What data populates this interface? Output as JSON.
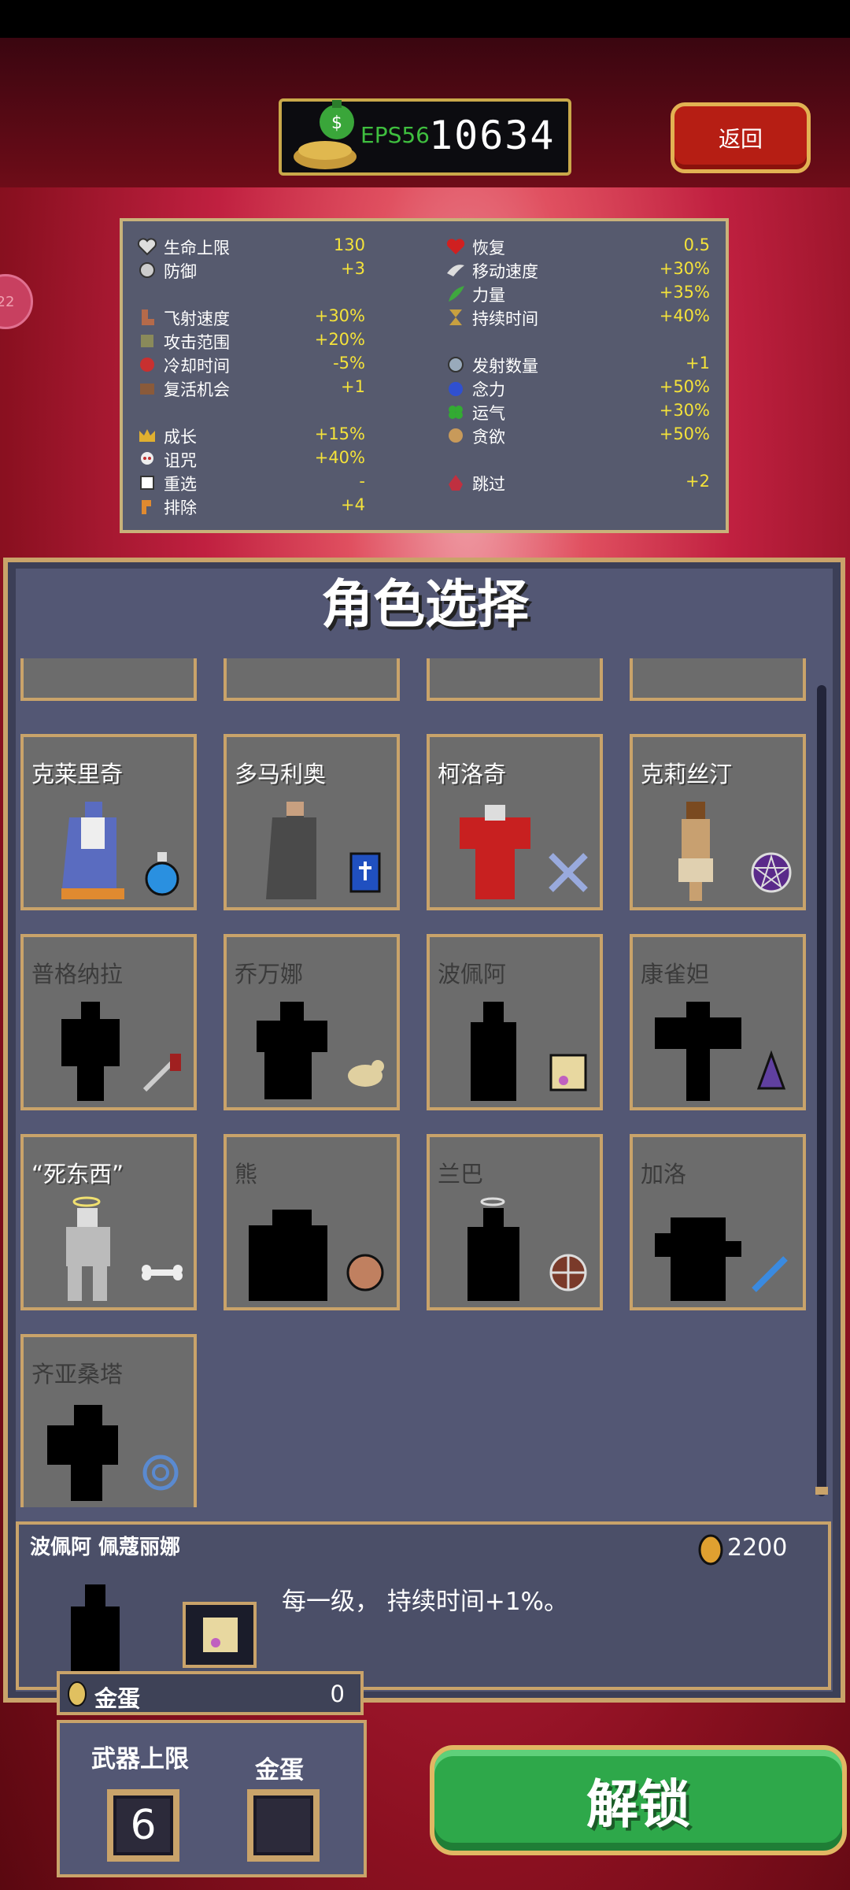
{
  "header": {
    "fps_label": "EPS56",
    "coins": "10634",
    "back_label": "返回"
  },
  "side_badge": "22",
  "stats": {
    "left": [
      {
        "label": "生命上限",
        "value": "130",
        "icon": "heart-icon"
      },
      {
        "label": "防御",
        "value": "+3",
        "icon": "armor-icon"
      },
      {
        "label": "飞射速度",
        "value": "+30%",
        "icon": "boot-icon"
      },
      {
        "label": "攻击范围",
        "value": "+20%",
        "icon": "area-icon"
      },
      {
        "label": "冷却时间",
        "value": "-5%",
        "icon": "cooldown-icon"
      },
      {
        "label": "复活机会",
        "value": "+1",
        "icon": "revival-icon"
      },
      {
        "label": "成长",
        "value": "+15%",
        "icon": "crown-icon"
      },
      {
        "label": "诅咒",
        "value": "+40%",
        "icon": "skull-icon"
      },
      {
        "label": "重选",
        "value": "-",
        "icon": "dice-icon"
      },
      {
        "label": "排除",
        "value": "+4",
        "icon": "banish-icon"
      }
    ],
    "right": [
      {
        "label": "恢复",
        "value": "0.5",
        "icon": "regen-heart-icon"
      },
      {
        "label": "移动速度",
        "value": "+30%",
        "icon": "wing-icon"
      },
      {
        "label": "力量",
        "value": "+35%",
        "icon": "feather-icon"
      },
      {
        "label": "持续时间",
        "value": "+40%",
        "icon": "hourglass-icon"
      },
      {
        "label": "发射数量",
        "value": "+1",
        "icon": "amount-icon"
      },
      {
        "label": "念力",
        "value": "+50%",
        "icon": "orb-icon"
      },
      {
        "label": "运气",
        "value": "+30%",
        "icon": "clover-icon"
      },
      {
        "label": "贪欲",
        "value": "+50%",
        "icon": "greed-icon"
      },
      {
        "label": "跳过",
        "value": "+2",
        "icon": "skip-icon"
      }
    ]
  },
  "title": "角色选择",
  "characters": [
    {
      "name": "克莱里奇",
      "locked": false,
      "item": "potion-icon"
    },
    {
      "name": "多马利奥",
      "locked": false,
      "item": "bible-icon"
    },
    {
      "name": "柯洛奇",
      "locked": false,
      "item": "cross-icon"
    },
    {
      "name": "克莉丝汀",
      "locked": false,
      "item": "pentagram-icon"
    },
    {
      "name": "普格纳拉",
      "locked": true,
      "item": "wand-icon"
    },
    {
      "name": "乔万娜",
      "locked": true,
      "item": "cat-icon"
    },
    {
      "name": "波佩阿",
      "locked": true,
      "item": "scroll-icon"
    },
    {
      "name": "康雀妲",
      "locked": true,
      "item": "bell-icon"
    },
    {
      "name": "“死东西”",
      "locked": false,
      "item": "bone-icon"
    },
    {
      "name": "熊",
      "locked": true,
      "item": "ball-icon"
    },
    {
      "name": "兰巴",
      "locked": true,
      "item": "wheel-icon"
    },
    {
      "name": "加洛",
      "locked": true,
      "item": "sword-icon"
    },
    {
      "name": "齐亚桑塔",
      "locked": true,
      "item": "spiral-icon"
    }
  ],
  "detail": {
    "name": "波佩阿 佩蔻丽娜",
    "price": "2200",
    "description": "每一级， 持续时间+1%。"
  },
  "golden_egg": {
    "label": "金蛋",
    "value": "0"
  },
  "weapon_box": {
    "limit_label": "武器上限",
    "egg_label": "金蛋",
    "limit_value": "6"
  },
  "unlock_label": "解锁"
}
